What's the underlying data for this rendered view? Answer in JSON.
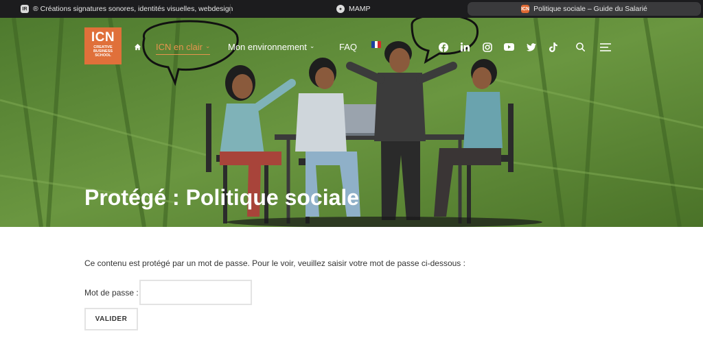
{
  "browser": {
    "tabs": [
      {
        "icon": "ir-favicon",
        "label": "® Créations signatures sonores, identités visuelles, webdesign"
      },
      {
        "icon": "mamp-favicon",
        "label": "MAMP"
      },
      {
        "icon": "icn-favicon",
        "label": "Politique sociale – Guide du Salarié",
        "active": true
      }
    ]
  },
  "logo": {
    "line1": "ICN",
    "line2": "CREATIVE",
    "line3": "BUSINESS",
    "line4": "SCHOOL"
  },
  "nav": {
    "items": [
      {
        "label": "ICN en clair",
        "active": true
      },
      {
        "label": "Mon environnement"
      },
      {
        "label": "FAQ"
      }
    ]
  },
  "socials": [
    "facebook-icon",
    "linkedin-icon",
    "instagram-icon",
    "youtube-icon",
    "twitter-icon",
    "tiktok-icon",
    "search-icon",
    "menu-icon"
  ],
  "page": {
    "title": "Protégé : Politique sociale",
    "notice": "Ce contenu est protégé par un mot de passe. Pour le voir, veuillez saisir votre mot de passe ci-dessous :",
    "password_label": "Mot de passe :",
    "password_value": "",
    "submit_label": "VALIDER"
  },
  "colors": {
    "accent": "#e8944e",
    "hero_green": "#5f8a3a",
    "logo_orange": "#e0703a"
  }
}
